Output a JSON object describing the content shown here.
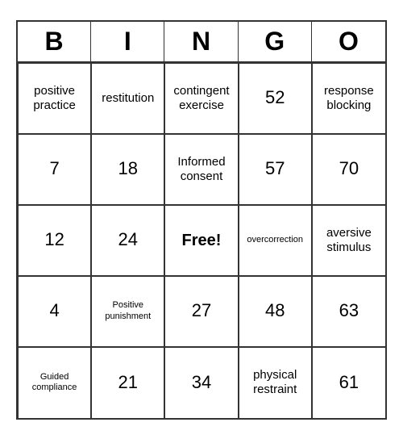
{
  "header": {
    "letters": [
      "B",
      "I",
      "N",
      "G",
      "O"
    ]
  },
  "cells": [
    {
      "text": "positive practice",
      "size": "normal"
    },
    {
      "text": "restitution",
      "size": "normal"
    },
    {
      "text": "contingent exercise",
      "size": "normal"
    },
    {
      "text": "52",
      "size": "large"
    },
    {
      "text": "response blocking",
      "size": "normal"
    },
    {
      "text": "7",
      "size": "large"
    },
    {
      "text": "18",
      "size": "large"
    },
    {
      "text": "Informed consent",
      "size": "normal"
    },
    {
      "text": "57",
      "size": "large"
    },
    {
      "text": "70",
      "size": "large"
    },
    {
      "text": "12",
      "size": "large"
    },
    {
      "text": "24",
      "size": "large"
    },
    {
      "text": "Free!",
      "size": "free"
    },
    {
      "text": "overcorrection",
      "size": "small"
    },
    {
      "text": "aversive stimulus",
      "size": "normal"
    },
    {
      "text": "4",
      "size": "large"
    },
    {
      "text": "Positive punishment",
      "size": "small"
    },
    {
      "text": "27",
      "size": "large"
    },
    {
      "text": "48",
      "size": "large"
    },
    {
      "text": "63",
      "size": "large"
    },
    {
      "text": "Guided compliance",
      "size": "small"
    },
    {
      "text": "21",
      "size": "large"
    },
    {
      "text": "34",
      "size": "large"
    },
    {
      "text": "physical restraint",
      "size": "normal"
    },
    {
      "text": "61",
      "size": "large"
    }
  ]
}
